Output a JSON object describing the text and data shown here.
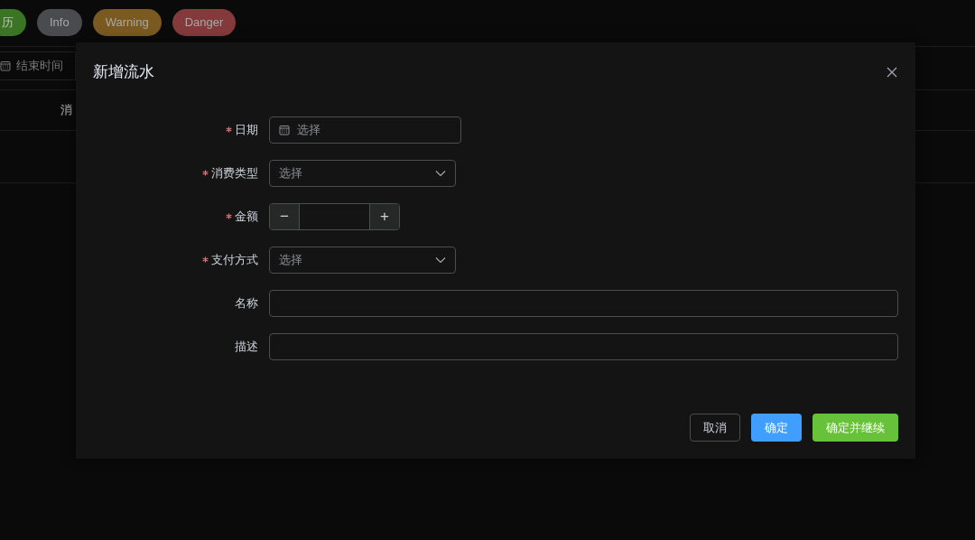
{
  "background": {
    "buttons": [
      {
        "label": "历",
        "kind": "success"
      },
      {
        "label": "Info",
        "kind": "info"
      },
      {
        "label": "Warning",
        "kind": "warning"
      },
      {
        "label": "Danger",
        "kind": "danger"
      }
    ],
    "date_range": {
      "end_placeholder": "结束时间"
    },
    "table": {
      "columns": [
        "消"
      ]
    }
  },
  "dialog": {
    "title": "新增流水",
    "fields": [
      {
        "label": "日期",
        "required": true,
        "kind": "date",
        "placeholder": "选择"
      },
      {
        "label": "消费类型",
        "required": true,
        "kind": "select",
        "placeholder": "选择"
      },
      {
        "label": "金额",
        "required": true,
        "kind": "number",
        "minus": "−",
        "plus": "+"
      },
      {
        "label": "支付方式",
        "required": true,
        "kind": "select",
        "placeholder": "选择"
      },
      {
        "label": "名称",
        "required": false,
        "kind": "text"
      },
      {
        "label": "描述",
        "required": false,
        "kind": "text"
      }
    ],
    "buttons": [
      {
        "label": "取消",
        "kind": "default"
      },
      {
        "label": "确定",
        "kind": "primary"
      },
      {
        "label": "确定并继续",
        "kind": "success"
      }
    ]
  }
}
